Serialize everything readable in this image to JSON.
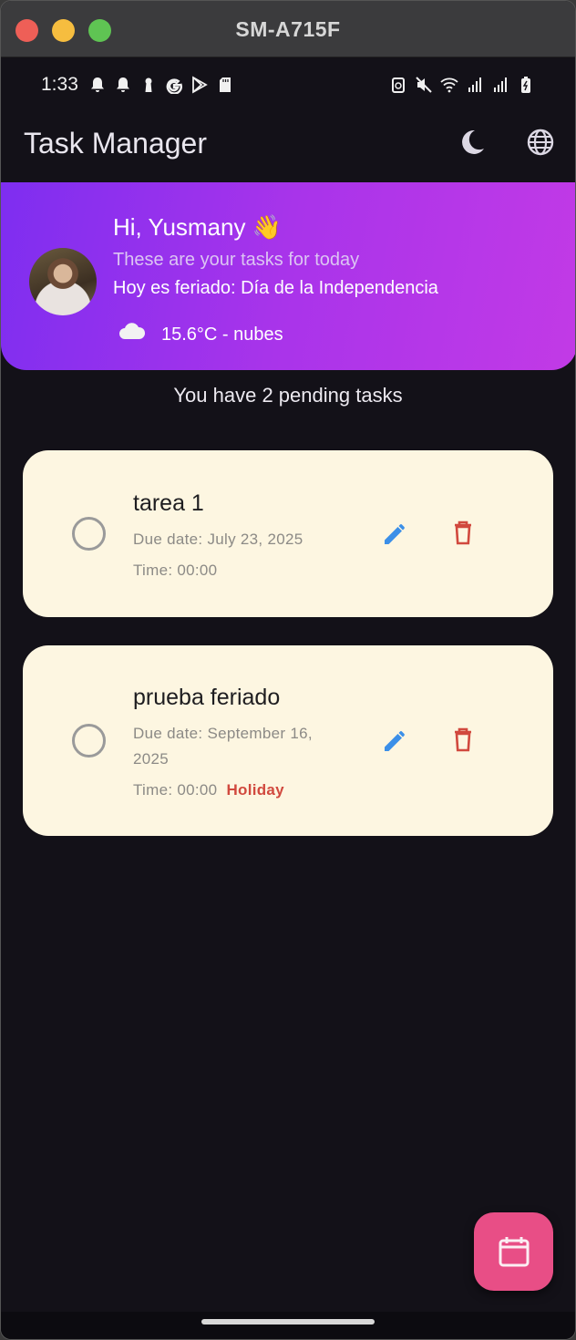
{
  "window": {
    "title": "SM-A715F"
  },
  "status_bar": {
    "time": "1:33",
    "left_icons": [
      "bell-icon",
      "bell-icon",
      "keyhole-icon",
      "google-icon",
      "play-store-icon",
      "sd-card-icon"
    ],
    "right_icons": [
      "battery-saver-icon",
      "mute-icon",
      "wifi-icon",
      "signal-icon",
      "signal-icon",
      "battery-icon"
    ]
  },
  "app_bar": {
    "title": "Task Manager",
    "actions": [
      "dark-mode-icon",
      "language-globe-icon"
    ]
  },
  "header": {
    "greeting": "Hi, Yusmany 👋",
    "subtitle": "These are your tasks for today",
    "holiday": "Hoy es feriado: Día de la Independencia",
    "weather": "15.6°C - nubes",
    "colors": {
      "gradient_start": "#7e2ef0",
      "gradient_end": "#c23ae6"
    }
  },
  "summary": {
    "pending_text": "You have 2 pending tasks"
  },
  "tasks": [
    {
      "title": "tarea 1",
      "due_date": "Due date: July 23, 2025",
      "time": "Time: 00:00",
      "tag": "",
      "completed": false
    },
    {
      "title": "prueba feriado",
      "due_date": "Due date: September 16, 2025",
      "time": "Time: 00:00",
      "tag": "Holiday",
      "completed": false
    }
  ],
  "fab": {
    "icon": "calendar-icon",
    "color": "#e84e86"
  },
  "colors": {
    "background": "#131118",
    "card": "#fdf6e1",
    "edit": "#3b8fe8",
    "delete": "#d1493e",
    "holiday_tag": "#d1493e"
  }
}
